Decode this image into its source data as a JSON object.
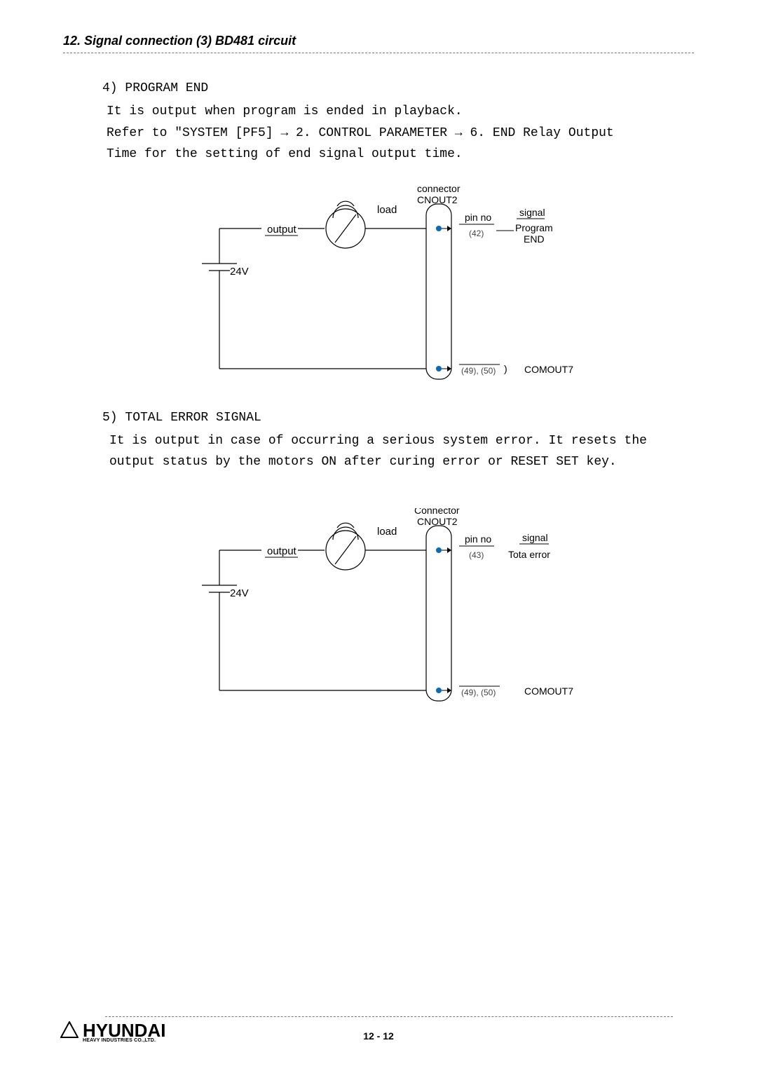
{
  "header": {
    "title": "12. Signal connection (3) BD481 circuit"
  },
  "section4": {
    "head": "4) PROGRAM END",
    "line1": "It is output when program is ended in playback.",
    "line2": "Refer to  \"SYSTEM [PF5] →  2. CONTROL PARAMETER →  6. END Relay Output",
    "line3": "Time  for the setting of end signal output time."
  },
  "diagram1": {
    "load": "load",
    "output": "output",
    "volt": "24V",
    "connector1": "connector",
    "connector2": "CNOUT2",
    "pinno": "pin no",
    "pin42": "(42)",
    "signal": "signal",
    "sig1": "Program",
    "sig2": "END",
    "pin4950": "(49), (50)",
    "paren": ")",
    "comout": "COMOUT7"
  },
  "section5": {
    "head": "5) TOTAL ERROR SIGNAL",
    "line1": "It is output in case of occurring a serious system error. It resets the",
    "line2": "output status by the motors ON after curing error or  RESET   SET  key."
  },
  "diagram2": {
    "load": "load",
    "output": "output",
    "volt": "24V",
    "connector1": "Connector",
    "connector2": "CNOUT2",
    "pinno": "pin no",
    "pin43": "(43)",
    "signal": "signal",
    "sig": "Tota error",
    "pin4950": "(49), (50)",
    "comout": "COMOUT7"
  },
  "footer": {
    "logo": "HYUNDAI",
    "logo_sub": "HEAVY INDUSTRIES CO.,LTD.",
    "page": "12 - 12"
  }
}
